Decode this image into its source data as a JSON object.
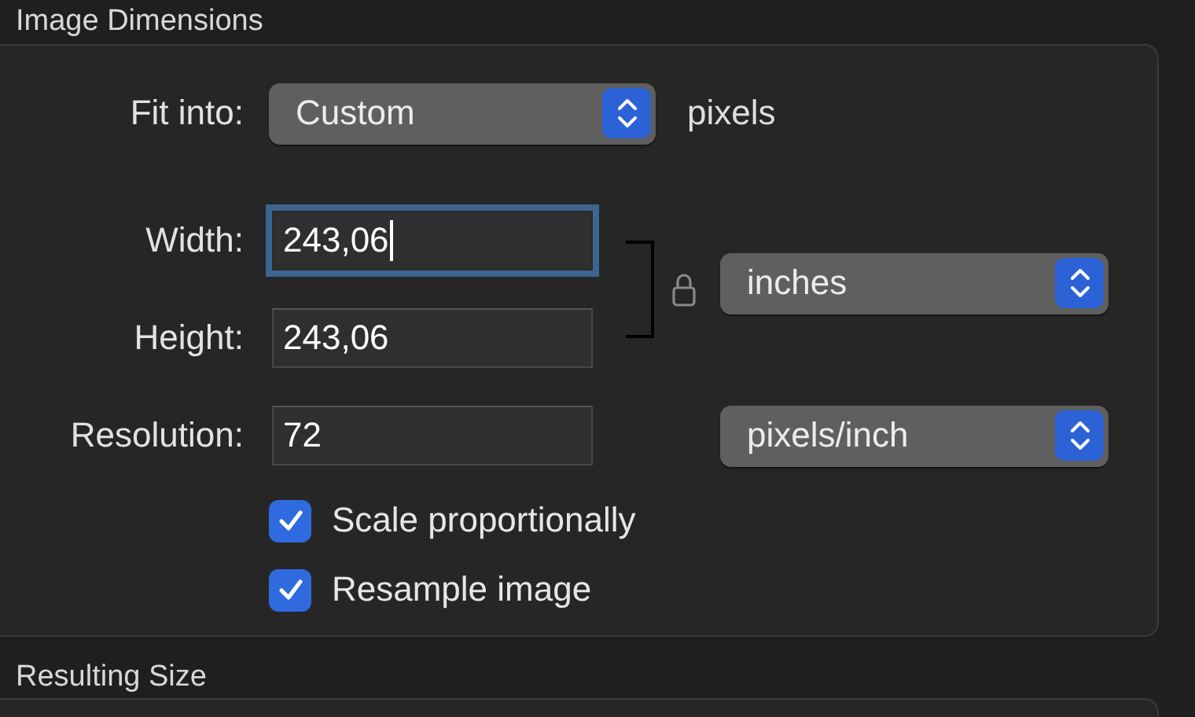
{
  "section_title": "Image Dimensions",
  "fit_into": {
    "label": "Fit into:",
    "value": "Custom",
    "unit": "pixels"
  },
  "width": {
    "label": "Width:",
    "value": "243,06",
    "focused": true
  },
  "height": {
    "label": "Height:",
    "value": "243,06",
    "focused": false
  },
  "size_unit": {
    "value": "inches"
  },
  "resolution": {
    "label": "Resolution:",
    "value": "72",
    "focused": false,
    "unit": "pixels/inch"
  },
  "checkboxes": [
    {
      "label": "Scale proportionally",
      "checked": true
    },
    {
      "label": "Resample image",
      "checked": true
    }
  ],
  "next_section_title": "Resulting Size"
}
